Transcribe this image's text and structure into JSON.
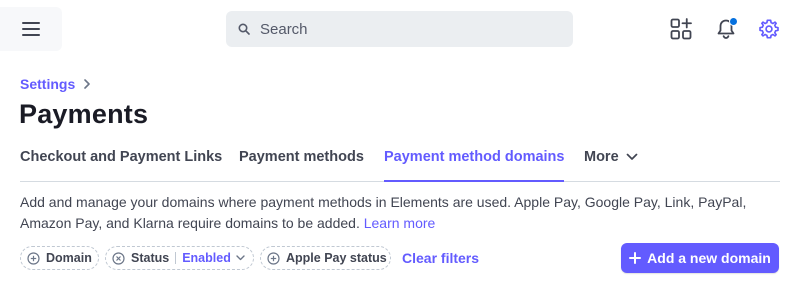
{
  "topbar": {
    "search_placeholder": "Search",
    "icons": [
      "menu-icon",
      "search-icon",
      "apps-plus-icon",
      "bell-icon",
      "gear-icon"
    ]
  },
  "breadcrumb": {
    "items": [
      {
        "label": "Settings"
      }
    ]
  },
  "page": {
    "title": "Payments"
  },
  "tabs": [
    {
      "label": "Checkout and Payment Links",
      "active": false
    },
    {
      "label": "Payment methods",
      "active": false
    },
    {
      "label": "Payment method domains",
      "active": true
    },
    {
      "label": "More",
      "active": false
    }
  ],
  "description": {
    "text": "Add and manage your domains where payment methods in Elements are used. Apple Pay, Google Pay, Link, PayPal, Amazon Pay, and Klarna require domains to be added. ",
    "link": "Learn more"
  },
  "filters": {
    "domain_label": "Domain",
    "status_label": "Status",
    "status_value": "Enabled",
    "apple_pay_label": "Apple Pay status",
    "clear_label": "Clear filters"
  },
  "actions": {
    "add_domain_label": "Add a new domain"
  },
  "colors": {
    "accent": "#635bff",
    "notification_dot": "#0570de",
    "text": "#414552"
  }
}
